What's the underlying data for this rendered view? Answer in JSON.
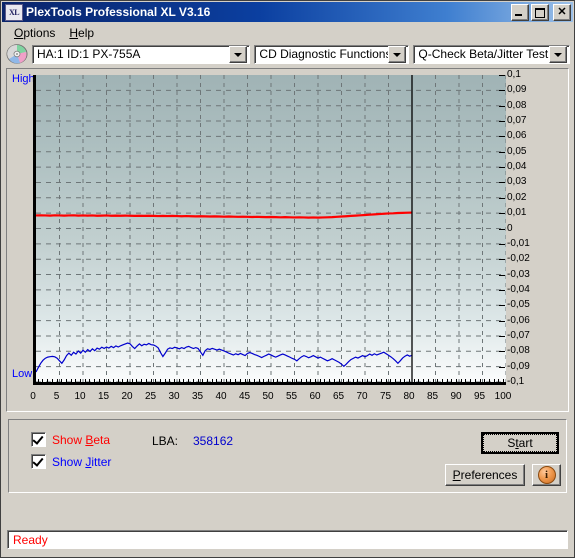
{
  "window": {
    "title": "PlexTools Professional XL V3.16",
    "icon": "XL",
    "buttons": {
      "minimize": "minimize-icon",
      "maximize": "maximize-icon",
      "close": "close-icon"
    }
  },
  "menu": {
    "items": [
      {
        "label": "Options",
        "accel": "O"
      },
      {
        "label": "Help",
        "accel": "H"
      }
    ]
  },
  "toolbar": {
    "disc_icon": "cd-disc-icon",
    "drive": {
      "value": "HA:1 ID:1  PX-755A"
    },
    "function": {
      "value": "CD Diagnostic Functions"
    },
    "test": {
      "value": "Q-Check Beta/Jitter Test"
    }
  },
  "controls": {
    "show_beta": {
      "label_pre": "Show ",
      "accel": "B",
      "label_post": "eta",
      "checked": true,
      "color": "#ff0000"
    },
    "show_jitter": {
      "label_pre": "Show ",
      "accel": "J",
      "label_post": "itter",
      "checked": true,
      "color": "#0000ff"
    },
    "lba_label": "LBA:",
    "lba_value": "358162",
    "start_button": "Start",
    "start_accel": "S",
    "preferences_button": "Preferences",
    "preferences_accel": "P",
    "info_button": "info-icon",
    "info_glyph": "i"
  },
  "status": {
    "text": "Ready"
  },
  "chart_data": {
    "type": "line",
    "title": "",
    "xlabel": "",
    "ylabel": "",
    "high_label": "High",
    "low_label": "Low",
    "xlim": [
      0,
      100
    ],
    "ylim": [
      -0.1,
      0.1
    ],
    "grid": true,
    "x_ticks": [
      0,
      5,
      10,
      15,
      20,
      25,
      30,
      35,
      40,
      45,
      50,
      55,
      60,
      65,
      70,
      75,
      80,
      85,
      90,
      95,
      100
    ],
    "y_ticks": [
      "0,1",
      "0,09",
      "0,08",
      "0,07",
      "0,06",
      "0,05",
      "0,04",
      "0,03",
      "0,02",
      "0,01",
      "0",
      "-0,01",
      "-0,02",
      "-0,03",
      "-0,04",
      "-0,05",
      "-0,06",
      "-0,07",
      "-0,08",
      "-0,09",
      "-0,1"
    ],
    "y_tick_values": [
      0.1,
      0.09,
      0.08,
      0.07,
      0.06,
      0.05,
      0.04,
      0.03,
      0.02,
      0.01,
      0,
      -0.01,
      -0.02,
      -0.03,
      -0.04,
      -0.05,
      -0.06,
      -0.07,
      -0.08,
      -0.09,
      -0.1
    ],
    "data_end_x": 80,
    "marker_line_x": 80,
    "background_gradient": [
      "#a0b3b5",
      "#fbfcfc"
    ],
    "series": [
      {
        "name": "Beta",
        "color": "#ff0000",
        "x": [
          0,
          1,
          2,
          3,
          4,
          5,
          6,
          7,
          8,
          9,
          10,
          11,
          12,
          13,
          14,
          15,
          16,
          17,
          18,
          19,
          20,
          21,
          22,
          23,
          24,
          25,
          26,
          27,
          28,
          29,
          30,
          31,
          32,
          33,
          34,
          35,
          36,
          37,
          38,
          39,
          40,
          41,
          42,
          43,
          44,
          45,
          46,
          47,
          48,
          49,
          50,
          51,
          52,
          53,
          54,
          55,
          56,
          57,
          58,
          59,
          60,
          61,
          62,
          63,
          64,
          65,
          66,
          67,
          68,
          69,
          70,
          71,
          72,
          73,
          74,
          75,
          76,
          77,
          78,
          79,
          80
        ],
        "values": [
          0.0085,
          0.0086,
          0.0085,
          0.0084,
          0.0086,
          0.0085,
          0.0084,
          0.0085,
          0.0086,
          0.0084,
          0.0085,
          0.0084,
          0.0085,
          0.0083,
          0.0084,
          0.0085,
          0.0083,
          0.0084,
          0.0083,
          0.0084,
          0.0083,
          0.0082,
          0.0083,
          0.0082,
          0.0083,
          0.0082,
          0.0081,
          0.0082,
          0.0081,
          0.0082,
          0.0081,
          0.008,
          0.0081,
          0.008,
          0.0079,
          0.008,
          0.0079,
          0.0078,
          0.0079,
          0.0078,
          0.0077,
          0.0078,
          0.0077,
          0.0076,
          0.0077,
          0.0076,
          0.0075,
          0.0076,
          0.0075,
          0.0074,
          0.0075,
          0.0074,
          0.0073,
          0.0074,
          0.0073,
          0.0072,
          0.0073,
          0.0072,
          0.0071,
          0.0072,
          0.0071,
          0.0072,
          0.0073,
          0.0074,
          0.0076,
          0.0078,
          0.008,
          0.0082,
          0.0084,
          0.0086,
          0.0088,
          0.009,
          0.0092,
          0.0094,
          0.0096,
          0.0098,
          0.0099,
          0.0101,
          0.0102,
          0.0103,
          0.0104
        ]
      },
      {
        "name": "Jitter",
        "color": "#0000cd",
        "x": [
          0,
          0.5,
          1,
          1.5,
          2,
          2.5,
          3,
          3.5,
          4,
          4.5,
          5,
          5.5,
          6,
          6.5,
          7,
          7.5,
          8,
          8.5,
          9,
          9.5,
          10,
          10.5,
          11,
          11.5,
          12,
          12.5,
          13,
          13.5,
          14,
          14.5,
          15,
          15.5,
          16,
          16.5,
          17,
          17.5,
          18,
          18.5,
          19,
          19.5,
          20,
          20.5,
          21,
          21.5,
          22,
          22.5,
          23,
          23.5,
          24,
          24.5,
          25,
          25.5,
          26,
          26.5,
          27,
          27.5,
          28,
          28.5,
          29,
          29.5,
          30,
          30.5,
          31,
          31.5,
          32,
          32.5,
          33,
          33.5,
          34,
          34.5,
          35,
          35.5,
          36,
          36.5,
          37,
          37.5,
          38,
          38.5,
          39,
          39.5,
          40,
          40.5,
          41,
          41.5,
          42,
          42.5,
          43,
          43.5,
          44,
          44.5,
          45,
          45.5,
          46,
          46.5,
          47,
          47.5,
          48,
          48.5,
          49,
          49.5,
          50,
          50.5,
          51,
          51.5,
          52,
          52.5,
          53,
          53.5,
          54,
          54.5,
          55,
          55.5,
          56,
          56.5,
          57,
          57.5,
          58,
          58.5,
          59,
          59.5,
          60,
          60.5,
          61,
          61.5,
          62,
          62.5,
          63,
          63.5,
          64,
          64.5,
          65,
          65.5,
          66,
          66.5,
          67,
          67.5,
          68,
          68.5,
          69,
          69.5,
          70,
          70.5,
          71,
          71.5,
          72,
          72.5,
          73,
          73.5,
          74,
          74.5,
          75,
          75.5,
          76,
          76.5,
          77,
          77.5,
          78,
          78.5,
          79,
          79.5,
          80
        ],
        "values": [
          -0.0935,
          -0.0905,
          -0.0878,
          -0.0858,
          -0.0845,
          -0.0838,
          -0.0835,
          -0.0833,
          -0.0836,
          -0.0845,
          -0.0862,
          -0.0878,
          -0.0856,
          -0.0828,
          -0.0812,
          -0.0826,
          -0.0806,
          -0.0818,
          -0.0798,
          -0.0812,
          -0.0793,
          -0.0806,
          -0.0789,
          -0.0801,
          -0.0784,
          -0.0796,
          -0.0779,
          -0.0786,
          -0.0773,
          -0.0781,
          -0.0772,
          -0.0779,
          -0.0768,
          -0.0776,
          -0.0765,
          -0.0772,
          -0.0764,
          -0.0758,
          -0.0752,
          -0.0746,
          -0.0751,
          -0.0768,
          -0.0782,
          -0.0766,
          -0.0752,
          -0.0764,
          -0.0754,
          -0.0758,
          -0.0749,
          -0.0757,
          -0.0759,
          -0.0766,
          -0.0778,
          -0.0808,
          -0.0834,
          -0.0812,
          -0.0786,
          -0.0778,
          -0.0782,
          -0.0774,
          -0.0778,
          -0.0784,
          -0.0776,
          -0.0782,
          -0.0772,
          -0.0768,
          -0.0776,
          -0.0782,
          -0.0776,
          -0.0782,
          -0.0804,
          -0.0826,
          -0.0796,
          -0.0784,
          -0.0788,
          -0.0781,
          -0.0786,
          -0.0792,
          -0.0786,
          -0.0792,
          -0.0798,
          -0.0804,
          -0.0812,
          -0.0818,
          -0.0824,
          -0.0816,
          -0.0822,
          -0.0814,
          -0.0821,
          -0.0828,
          -0.0814,
          -0.0808,
          -0.0814,
          -0.0821,
          -0.0826,
          -0.0833,
          -0.0841,
          -0.0833,
          -0.0826,
          -0.0818,
          -0.0824,
          -0.0832,
          -0.0838,
          -0.0831,
          -0.0824,
          -0.0818,
          -0.0824,
          -0.0831,
          -0.0838,
          -0.0846,
          -0.0852,
          -0.0862,
          -0.0848,
          -0.0836,
          -0.0828,
          -0.0834,
          -0.0842,
          -0.0836,
          -0.0828,
          -0.0836,
          -0.0844,
          -0.0838,
          -0.0846,
          -0.0854,
          -0.0862,
          -0.0856,
          -0.0848,
          -0.0856,
          -0.0864,
          -0.0872,
          -0.0884,
          -0.0898,
          -0.0884,
          -0.0868,
          -0.0854,
          -0.0846,
          -0.0838,
          -0.0844,
          -0.0836,
          -0.0828,
          -0.0836,
          -0.0828,
          -0.0818,
          -0.0826,
          -0.0816,
          -0.0824,
          -0.0818,
          -0.0812,
          -0.0806,
          -0.0816,
          -0.0826,
          -0.0836,
          -0.0848,
          -0.0862,
          -0.0878,
          -0.0862,
          -0.0844,
          -0.0832,
          -0.0824,
          -0.0832,
          -0.0826,
          -0.0818,
          -0.0826
        ]
      }
    ]
  }
}
